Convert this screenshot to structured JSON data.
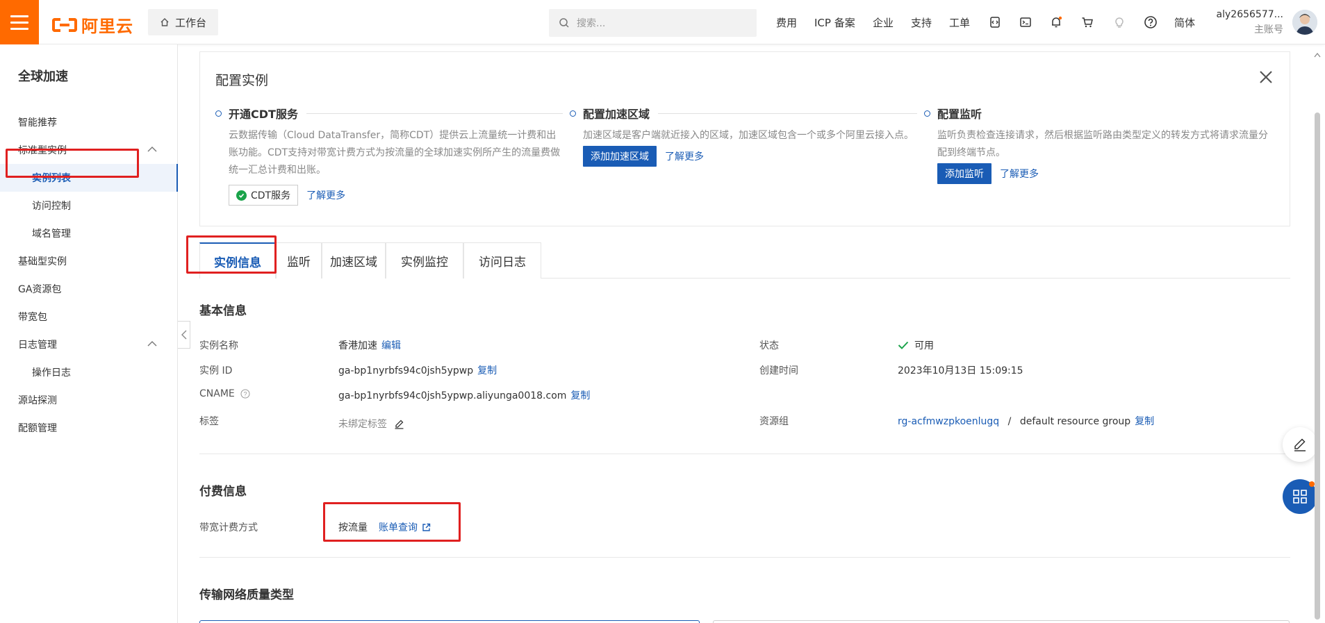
{
  "topbar": {
    "logo_text": "阿里云",
    "workbench": "工作台",
    "search_placeholder": "搜索...",
    "nav": [
      "费用",
      "ICP 备案",
      "企业",
      "支持",
      "工单"
    ],
    "lang": "简体",
    "user_name": "aly2656577...",
    "user_role": "主账号",
    "brand_color": "#ff6a00"
  },
  "sidebar": {
    "title": "全球加速",
    "items": [
      {
        "label": "智能推荐"
      },
      {
        "label": "标准型实例"
      },
      {
        "label": "实例列表"
      },
      {
        "label": "访问控制"
      },
      {
        "label": "域名管理"
      },
      {
        "label": "基础型实例"
      },
      {
        "label": "GA资源包"
      },
      {
        "label": "带宽包"
      },
      {
        "label": "日志管理"
      },
      {
        "label": "操作日志"
      },
      {
        "label": "源站探测"
      },
      {
        "label": "配额管理"
      }
    ]
  },
  "config": {
    "title": "配置实例",
    "steps": [
      {
        "name": "开通CDT服务",
        "desc": "云数据传输（Cloud DataTransfer，简称CDT）提供云上流量统一计费和出账功能。CDT支持对带宽计费方式为按流量的全球加速实例所产生的流量费做统一汇总计费和出账。",
        "action": "CDT服务",
        "more": "了解更多"
      },
      {
        "name": "配置加速区域",
        "desc": "加速区域是客户端就近接入的区域，加速区域包含一个或多个阿里云接入点。",
        "action": "添加加速区域",
        "more": "了解更多"
      },
      {
        "name": "配置监听",
        "desc": "监听负责检查连接请求，然后根据监听路由类型定义的转发方式将请求流量分配到终端节点。",
        "action": "添加监听",
        "more": "了解更多"
      }
    ]
  },
  "tabs": [
    "实例信息",
    "监听",
    "加速区域",
    "实例监控",
    "访问日志"
  ],
  "basic": {
    "title": "基本信息",
    "name_label": "实例名称",
    "name_value": "香港加速",
    "edit": "编辑",
    "id_label": "实例 ID",
    "id_value": "ga-bp1nyrbfs94c0jsh5ypwp",
    "copy": "复制",
    "cname_label": "CNAME",
    "cname_value": "ga-bp1nyrbfs94c0jsh5ypwp.aliyunga0018.com",
    "tag_label": "标签",
    "tag_value": "未绑定标签",
    "status_label": "状态",
    "status_value": "可用",
    "created_label": "创建时间",
    "created_value": "2023年10月13日 15:09:15",
    "rg_label": "资源组",
    "rg_id": "rg-acfmwzpkoenlugq",
    "rg_sep": "/",
    "rg_name": "default resource group"
  },
  "billing": {
    "title": "付费信息",
    "method_label": "带宽计费方式",
    "method_value": "按流量",
    "bill_link": "账单查询"
  },
  "network": {
    "title": "传输网络质量类型"
  }
}
